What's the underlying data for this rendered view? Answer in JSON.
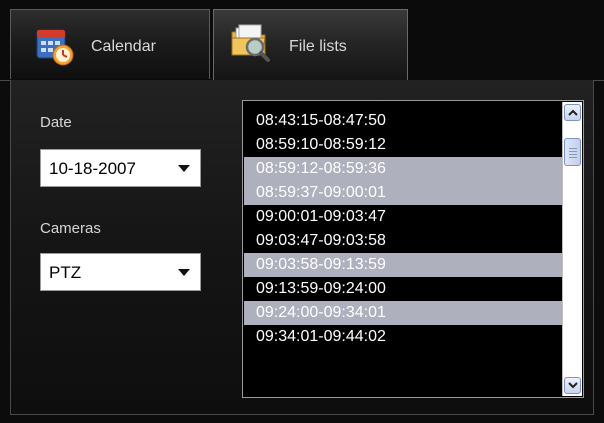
{
  "tabs": [
    {
      "label": "Calendar",
      "icon": "calendar-icon",
      "active": false
    },
    {
      "label": "File lists",
      "icon": "folder-search-icon",
      "active": true
    }
  ],
  "date": {
    "label": "Date",
    "value": "10-18-2007"
  },
  "cameras": {
    "label": "Cameras",
    "value": "PTZ"
  },
  "files": {
    "rows": [
      {
        "text": "08:43:15-08:47:50",
        "selected": false
      },
      {
        "text": "08:59:10-08:59:12",
        "selected": false
      },
      {
        "text": "08:59:12-08:59:36",
        "selected": true
      },
      {
        "text": "08:59:37-09:00:01",
        "selected": true
      },
      {
        "text": "09:00:01-09:03:47",
        "selected": false
      },
      {
        "text": "09:03:47-09:03:58",
        "selected": false
      },
      {
        "text": "09:03:58-09:13:59",
        "selected": true
      },
      {
        "text": "09:13:59-09:24:00",
        "selected": false
      },
      {
        "text": "09:24:00-09:34:01",
        "selected": true
      },
      {
        "text": "09:34:01-09:44:02",
        "selected": false
      }
    ]
  },
  "colors": {
    "selected_row": "#aeb0bd",
    "background": "#0c0c0c"
  }
}
